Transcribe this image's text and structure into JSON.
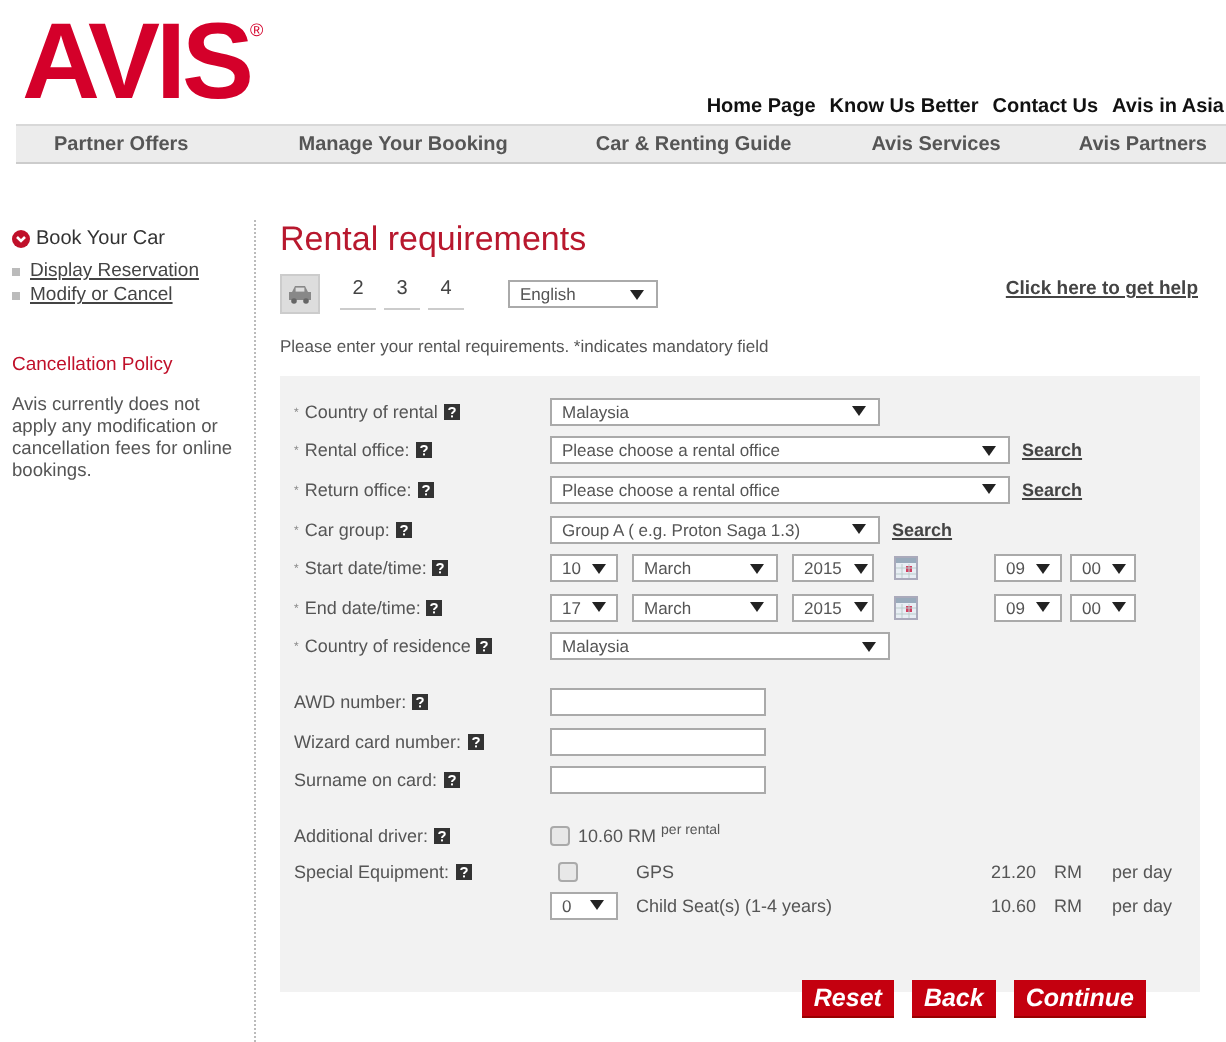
{
  "logo": {
    "text": "AVIS",
    "mark": "®"
  },
  "top_links": [
    "Home Page",
    "Know Us Better",
    "Contact Us",
    "Avis in Asia"
  ],
  "nav": [
    "Partner Offers",
    "Manage Your Booking",
    "Car & Renting Guide",
    "Avis Services",
    "Avis Partners"
  ],
  "sidebar": {
    "heading": "Book Your Car",
    "links": [
      "Display Reservation",
      "Modify or Cancel"
    ],
    "policy_title": "Cancellation Policy",
    "policy_text": "Avis currently does not apply any modification or cancellation fees for online bookings."
  },
  "title": "Rental requirements",
  "steps": [
    {
      "kind": "car",
      "selected": true
    },
    {
      "label": "2",
      "kind": "number",
      "selected": false
    },
    {
      "label": "3",
      "kind": "number",
      "selected": false
    },
    {
      "label": "4",
      "kind": "number",
      "selected": false
    }
  ],
  "language": "English",
  "help_link": "Click here to get help",
  "instruction": "Please enter your rental requirements. *indicates mandatory field",
  "rows": [
    {
      "mark": "*",
      "label": "Country of rental",
      "controls": [
        {
          "kind": "dropdown",
          "value": "Malaysia"
        }
      ]
    },
    {
      "mark": "*",
      "label": "Rental office:",
      "controls": [
        {
          "kind": "wide-dropdown",
          "value": "Please choose a rental office"
        },
        {
          "kind": "link",
          "value": "Search"
        }
      ]
    },
    {
      "mark": "*",
      "label": "Return office:",
      "controls": [
        {
          "kind": "wide-dropdown",
          "value": "Please choose a rental office"
        },
        {
          "kind": "link",
          "value": "Search"
        }
      ]
    },
    {
      "mark": "*",
      "label": "Car group:",
      "controls": [
        {
          "kind": "dropdown",
          "value": "Group A ( e.g. Proton Saga 1.3)"
        },
        {
          "kind": "link",
          "value": "Search"
        }
      ]
    },
    {
      "mark": "*",
      "label": "Start date/time:",
      "controls": [
        {
          "kind": "day",
          "value": "10"
        },
        {
          "kind": "month",
          "value": "March"
        },
        {
          "kind": "year",
          "value": "2015"
        },
        {
          "kind": "calendar"
        },
        {
          "kind": "hour",
          "value": "09"
        },
        {
          "kind": "minute",
          "value": "00"
        }
      ]
    },
    {
      "mark": "*",
      "label": "End date/time:",
      "controls": [
        {
          "kind": "day",
          "value": "17"
        },
        {
          "kind": "month",
          "value": "March"
        },
        {
          "kind": "year",
          "value": "2015"
        },
        {
          "kind": "calendar"
        },
        {
          "kind": "hour",
          "value": "09"
        },
        {
          "kind": "minute",
          "value": "00"
        }
      ]
    },
    {
      "mark": "*",
      "label": "Country of residence",
      "controls": [
        {
          "kind": "residence-dropdown",
          "value": "Malaysia"
        }
      ]
    },
    {
      "label": "AWD number:",
      "controls": [
        {
          "kind": "input"
        }
      ]
    },
    {
      "label": "Wizard card number:",
      "controls": [
        {
          "kind": "input"
        }
      ]
    },
    {
      "label": "Surname on card:",
      "controls": [
        {
          "kind": "input"
        }
      ]
    }
  ],
  "additional_driver": {
    "label": "Additional driver:",
    "checked": false,
    "price": "10.60 RM $^{per rental}$"
  },
  "special_equipment": {
    "label": "Special Equipment:",
    "items": [
      {
        "kind": "checkbox",
        "checked": false,
        "name": "GPS",
        "price": "21.20",
        "currency": "RM",
        "unit": "per day"
      },
      {
        "kind": "quantity",
        "value": "0",
        "name": "Child Seat(s) (1-4 years)",
        "price": "10.60",
        "currency": "RM",
        "unit": "per day"
      }
    ]
  },
  "buttons": [
    "Reset",
    "Back",
    "Continue"
  ]
}
